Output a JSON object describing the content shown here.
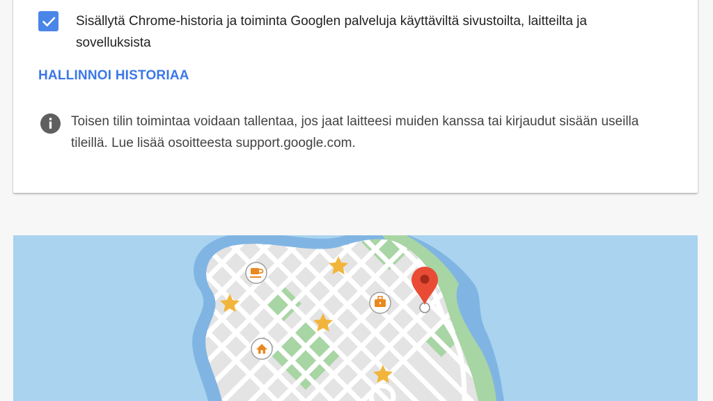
{
  "settings_card": {
    "checkbox": {
      "checked": true,
      "label": "Sisällytä Chrome-historia ja toiminta Googlen palveluja käyttäviltä sivustoilta, laitteilta ja sovelluksista"
    },
    "manage_history_label": "HALLINNOI HISTORIAA",
    "info_text": "Toisen tilin toimintaa voidaan tallentaa, jos jaat laitteesi muiden kanssa tai kirjaudut sisään useilla tileillä. Lue lisää osoitteesta support.google.com."
  },
  "illustration": {
    "colors": {
      "water": "#a9d3ef",
      "shore": "#80b5e3",
      "land": "#e4e4e4",
      "park": "#a8d5a4",
      "road": "#ffffff",
      "star": "#f2b53c",
      "pin": "#e94b35",
      "poi_icon": "#e8891f"
    },
    "icons": [
      "coffee-icon",
      "briefcase-icon",
      "home-icon",
      "star-icon",
      "location-pin-icon"
    ]
  }
}
